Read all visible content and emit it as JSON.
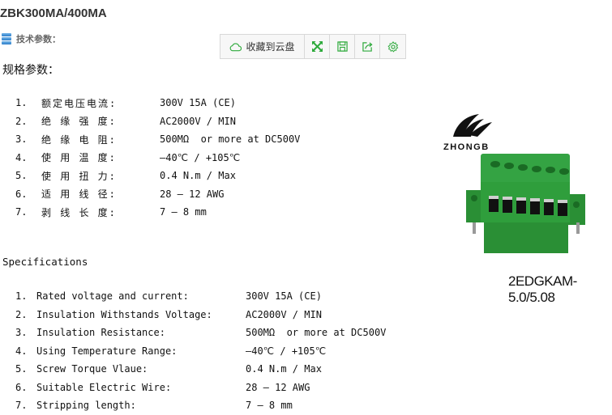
{
  "page": {
    "title": "ZBK300MA/400MA",
    "section_label": "技术参数：",
    "section_icon": "database-icon"
  },
  "toolbar": {
    "save_to_cloud_label": "收藏到云盘",
    "icons": [
      "cloud-icon",
      "fullscreen-icon",
      "save-icon",
      "share-icon",
      "settings-icon"
    ],
    "accent_color": "#2eaa3c"
  },
  "chinese_specs": {
    "heading": "规格参数：",
    "items": [
      {
        "num": "1.",
        "label": "额定电压电流:",
        "value": "300V 15A (CE)"
      },
      {
        "num": "2.",
        "label": "绝 缘 强 度:",
        "value": "AC2000V / MIN"
      },
      {
        "num": "3.",
        "label": "绝 缘 电 阻:",
        "value": "500MΩ  or more at DC500V"
      },
      {
        "num": "4.",
        "label": "使 用 温 度:",
        "value": "—40℃ / +105℃"
      },
      {
        "num": "5.",
        "label": "使 用 扭 力:",
        "value": "0.4 N.m / Max"
      },
      {
        "num": "6.",
        "label": "适 用 线 径:",
        "value": "28 — 12 AWG"
      },
      {
        "num": "7.",
        "label": "剥 线 长 度:",
        "value": "7 — 8 mm"
      }
    ]
  },
  "english_specs": {
    "heading": "Specifications",
    "items": [
      {
        "num": "1.",
        "label": "Rated voltage and current:",
        "value": "300V 15A (CE)"
      },
      {
        "num": "2.",
        "label": "Insulation Withstands Voltage:",
        "value": "AC2000V / MIN"
      },
      {
        "num": "3.",
        "label": "Insulation Resistance:",
        "value": "500MΩ  or more at DC500V"
      },
      {
        "num": "4.",
        "label": "Using Temperature Range:",
        "value": "—40℃ / +105℃"
      },
      {
        "num": "5.",
        "label": "Screw Torque Vlaue:",
        "value": "0.4 N.m / Max"
      },
      {
        "num": "6.",
        "label": "Suitable Electric Wire:",
        "value": "28 — 12 AWG"
      },
      {
        "num": "7.",
        "label": "Stripping length:",
        "value": "7 — 8 mm"
      }
    ]
  },
  "product": {
    "brand": "ZHONGB",
    "model": "2EDGKAM-5.0/5.08",
    "body_color": "#2f9e3c"
  }
}
